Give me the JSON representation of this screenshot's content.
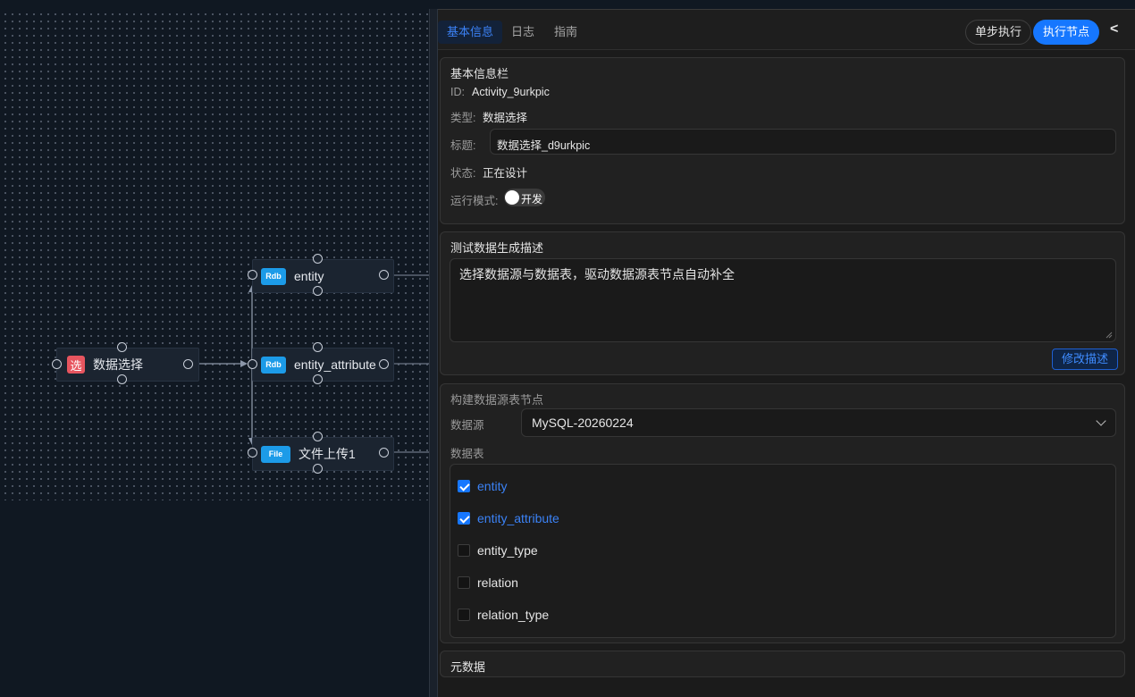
{
  "canvas": {
    "nodes": {
      "source": {
        "badge": "选",
        "label": "数据选择"
      },
      "entity": {
        "badge": "Rdb",
        "label": "entity"
      },
      "entity_attribute": {
        "badge": "Rdb",
        "label": "entity_attribute"
      },
      "file": {
        "badge": "File",
        "label": "文件上传1"
      }
    }
  },
  "panel": {
    "tabs": [
      {
        "label": "基本信息",
        "active": true
      },
      {
        "label": "日志",
        "active": false
      },
      {
        "label": "指南",
        "active": false
      }
    ],
    "step_button": "单步执行",
    "run_button": "执行节点",
    "collapse_icon": "<",
    "basic": {
      "title": "基本信息栏",
      "id_label": "ID:",
      "id_value": "Activity_9urkpic",
      "type_label": "类型:",
      "type_value": "数据选择",
      "name_label": "标题:",
      "name_value": "数据选择_d9urkpic",
      "status_label": "状态:",
      "status_value": "正在设计",
      "mode_label": "运行模式:",
      "mode_value": "开发"
    },
    "test_desc": {
      "title": "测试数据生成描述",
      "text": "选择数据源与数据表，驱动数据源表节点自动补全",
      "edit_button": "修改描述"
    },
    "build": {
      "title": "构建数据源表节点",
      "source_label": "数据源",
      "source_value": "MySQL-20260224",
      "tables_label": "数据表",
      "tables": [
        {
          "name": "entity",
          "checked": true
        },
        {
          "name": "entity_attribute",
          "checked": true
        },
        {
          "name": "entity_type",
          "checked": false
        },
        {
          "name": "relation",
          "checked": false
        },
        {
          "name": "relation_type",
          "checked": false
        }
      ]
    },
    "meta": {
      "title": "元数据"
    }
  },
  "colors": {
    "accent": "#1677ff",
    "canvas_bg": "#101822",
    "panel_bg": "#1b1b1b",
    "rdb_badge": "#1c9be8",
    "select_badge": "#e7555f"
  }
}
